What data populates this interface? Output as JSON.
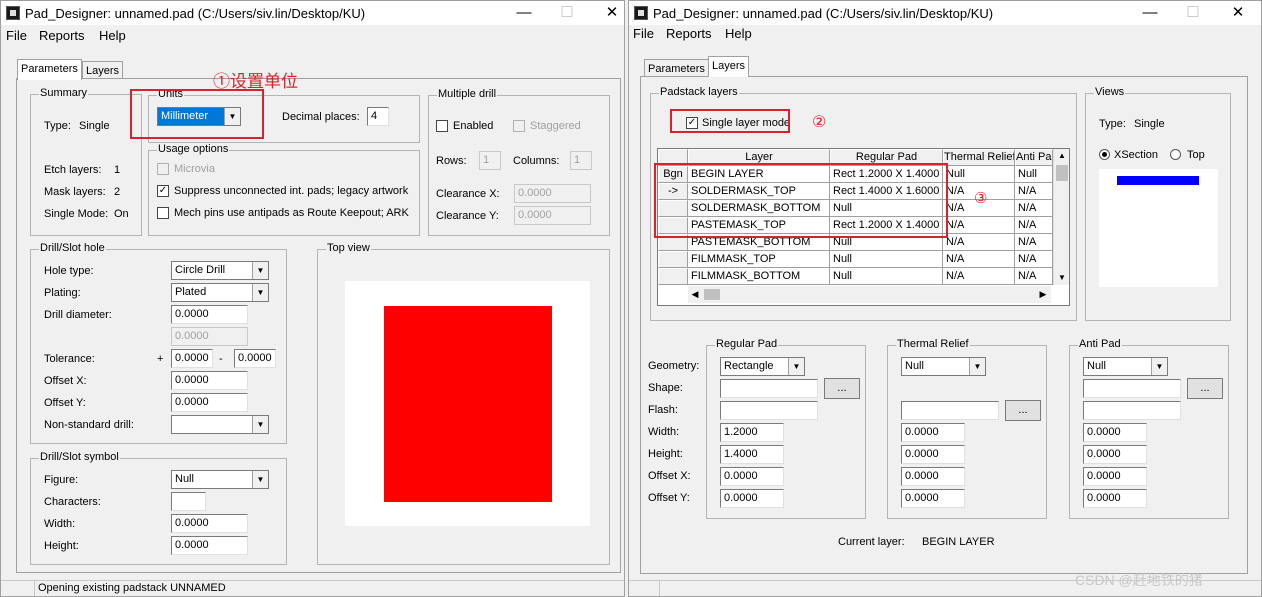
{
  "left_window": {
    "title": "Pad_Designer: unnamed.pad (C:/Users/siv.lin/Desktop/KU)",
    "menu": [
      "File",
      "Reports",
      "Help"
    ],
    "tabs": [
      "Parameters",
      "Layers"
    ],
    "summary": {
      "legend": "Summary",
      "type_label": "Type:",
      "type_value": "Single",
      "etch_label": "Etch layers:",
      "etch_value": "1",
      "mask_label": "Mask layers:",
      "mask_value": "2",
      "single_label": "Single Mode:",
      "single_value": "On"
    },
    "units": {
      "legend": "Units",
      "value": "Millimeter",
      "decimal_label": "Decimal places:",
      "decimal_value": "4"
    },
    "usage": {
      "legend": "Usage options",
      "microvia": "Microvia",
      "suppress": "Suppress unconnected int. pads; legacy artwork",
      "mech": "Mech pins use antipads as Route Keepout; ARK"
    },
    "multiple_drill": {
      "legend": "Multiple drill",
      "enabled": "Enabled",
      "staggered": "Staggered",
      "rows_label": "Rows:",
      "rows_value": "1",
      "columns_label": "Columns:",
      "columns_value": "1",
      "clearance_x_label": "Clearance X:",
      "clearance_x_value": "0.0000",
      "clearance_y_label": "Clearance Y:",
      "clearance_y_value": "0.0000"
    },
    "drill_slot_hole": {
      "legend": "Drill/Slot hole",
      "hole_type_label": "Hole type:",
      "hole_type_value": "Circle Drill",
      "plating_label": "Plating:",
      "plating_value": "Plated",
      "drill_diameter_label": "Drill diameter:",
      "drill_diameter_value": "0.0000",
      "drill_diameter_value2": "0.0000",
      "tolerance_label": "Tolerance:",
      "tol_plus": "+",
      "tol_plus_value": "0.0000",
      "tol_minus": "-",
      "tol_minus_value": "0.0000",
      "offset_x_label": "Offset X:",
      "offset_x_value": "0.0000",
      "offset_y_label": "Offset Y:",
      "offset_y_value": "0.0000",
      "nonstd_label": "Non-standard drill:",
      "nonstd_value": ""
    },
    "drill_slot_symbol": {
      "legend": "Drill/Slot symbol",
      "figure_label": "Figure:",
      "figure_value": "Null",
      "characters_label": "Characters:",
      "characters_value": "",
      "width_label": "Width:",
      "width_value": "0.0000",
      "height_label": "Height:",
      "height_value": "0.0000"
    },
    "top_view": {
      "legend": "Top view",
      "pad_color": "#ff0000"
    },
    "status": "Opening existing padstack UNNAMED",
    "annotation": "①设置单位"
  },
  "right_window": {
    "title": "Pad_Designer: unnamed.pad (C:/Users/siv.lin/Desktop/KU)",
    "menu": [
      "File",
      "Reports",
      "Help"
    ],
    "tabs": [
      "Parameters",
      "Layers"
    ],
    "padstack_layers": {
      "legend": "Padstack layers",
      "single_layer_mode": "Single layer mode",
      "annotation2": "②",
      "annotation3": "③",
      "headers": [
        "Layer",
        "Regular Pad",
        "Thermal Relief",
        "Anti Pad"
      ],
      "row_headers": [
        "Bgn",
        "->",
        "",
        "",
        "",
        "",
        ""
      ],
      "rows": [
        [
          "BEGIN LAYER",
          "Rect 1.2000 X 1.4000",
          "Null",
          "Null"
        ],
        [
          "SOLDERMASK_TOP",
          "Rect 1.4000 X 1.6000",
          "N/A",
          "N/A"
        ],
        [
          "SOLDERMASK_BOTTOM",
          "Null",
          "N/A",
          "N/A"
        ],
        [
          "PASTEMASK_TOP",
          "Rect 1.2000 X 1.4000",
          "N/A",
          "N/A"
        ],
        [
          "PASTEMASK_BOTTOM",
          "Null",
          "N/A",
          "N/A"
        ],
        [
          "FILMMASK_TOP",
          "Null",
          "N/A",
          "N/A"
        ],
        [
          "FILMMASK_BOTTOM",
          "Null",
          "N/A",
          "N/A"
        ]
      ]
    },
    "views": {
      "legend": "Views",
      "type_label": "Type:",
      "type_value": "Single",
      "xsection": "XSection",
      "top": "Top",
      "bar_color": "#0000ff"
    },
    "regular_pad": {
      "legend": "Regular Pad",
      "geometry_value": "Rectangle",
      "shape_value": "",
      "flash_value": "",
      "width_value": "1.2000",
      "height_value": "1.4000",
      "offset_x_value": "0.0000",
      "offset_y_value": "0.0000"
    },
    "thermal_relief": {
      "legend": "Thermal Relief",
      "geometry_value": "Null",
      "flash_value": "",
      "width_value": "0.0000",
      "height_value": "0.0000",
      "offset_x_value": "0.0000",
      "offset_y_value": "0.0000"
    },
    "anti_pad": {
      "legend": "Anti Pad",
      "geometry_value": "Null",
      "shape_value": "",
      "flash_value": "",
      "width_value": "0.0000",
      "height_value": "0.0000",
      "offset_x_value": "0.0000",
      "offset_y_value": "0.0000"
    },
    "field_labels": {
      "geometry": "Geometry:",
      "shape": "Shape:",
      "flash": "Flash:",
      "width": "Width:",
      "height": "Height:",
      "offset_x": "Offset X:",
      "offset_y": "Offset Y:"
    },
    "browse_label": "...",
    "current_layer_label": "Current layer:",
    "current_layer_value": "BEGIN LAYER",
    "watermark": "CSDN @赶地铁的猪"
  },
  "colors": {
    "annotation_red": "#d6232e",
    "selection_blue": "#0078d7"
  }
}
